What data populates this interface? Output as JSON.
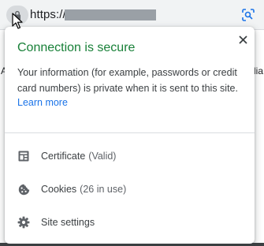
{
  "omnibox": {
    "url_prefix": "https://",
    "lock_icon": "lock-icon",
    "lens_icon": "lens-icon"
  },
  "bookmarks": {
    "left_fragment": "A",
    "right_fragment": "llia"
  },
  "popup": {
    "title": "Connection is secure",
    "description": "Your information (for example, passwords or credit card numbers) is private when it is sent to this site.",
    "learn_more": "Learn more",
    "items": [
      {
        "label": "Certificate",
        "sub": "(Valid)",
        "icon": "certificate-icon"
      },
      {
        "label": "Cookies",
        "sub": "(26 in use)",
        "icon": "cookie-icon"
      },
      {
        "label": "Site settings",
        "sub": "",
        "icon": "gear-icon"
      }
    ]
  },
  "colors": {
    "secure_green": "#188038",
    "link_blue": "#1a73e8",
    "text": "#3c4043"
  }
}
